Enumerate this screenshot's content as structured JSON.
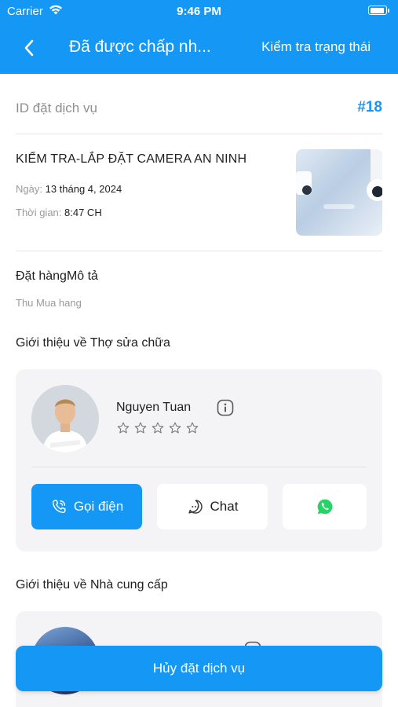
{
  "status_bar": {
    "carrier": "Carrier",
    "time": "9:46 PM",
    "battery_level": 0.95
  },
  "header": {
    "title": "Đã được chấp nh...",
    "action": "Kiểm tra trạng thái",
    "back_icon": "chevron-left-icon"
  },
  "booking": {
    "id_label": "ID đặt dịch vụ",
    "id_value": "#18"
  },
  "service": {
    "title": "KIỂM TRA-LẮP ĐẶT CAMERA AN NINH",
    "date_label": "Ngày:",
    "date_value": "13 tháng 4, 2024",
    "time_label": "Thời gian:",
    "time_value": "8:47 CH"
  },
  "order": {
    "heading": "Đặt hàngMô tả",
    "description": "Thu Mua hang"
  },
  "technician": {
    "heading": "Giới thiệu về Thợ sửa chữa",
    "name": "Nguyen Tuan",
    "rating": 0,
    "rating_max": 5,
    "call_label": "Gọi điện",
    "chat_label": "Chat",
    "whatsapp_icon": "whatsapp-icon"
  },
  "provider": {
    "heading": "Giới thiệu về Nhà cung cấp"
  },
  "footer": {
    "cancel_label": "Hủy đặt dịch vụ"
  },
  "colors": {
    "primary": "#1497f5",
    "card_bg": "#f4f4f6",
    "muted_text": "#9a9a9a",
    "whatsapp": "#25d366"
  }
}
